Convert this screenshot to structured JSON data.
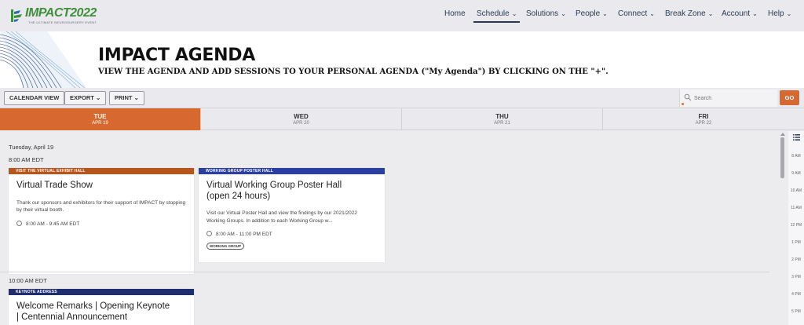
{
  "brand": {
    "name": "IMPACT2022",
    "tagline": "THE ULTIMATE NEUROSURGERY EVENT",
    "color": "#3f8f3a"
  },
  "nav": {
    "items": [
      {
        "label": "Home",
        "chevron": false
      },
      {
        "label": "Schedule",
        "chevron": true,
        "active": true
      },
      {
        "label": "Solutions",
        "chevron": true
      },
      {
        "label": "People",
        "chevron": true
      },
      {
        "label": "Connect",
        "chevron": true
      },
      {
        "label": "Break Zone",
        "chevron": true
      },
      {
        "label": "Account",
        "chevron": true
      },
      {
        "label": "Help",
        "chevron": true
      }
    ]
  },
  "banner": {
    "title": "IMPACT AGENDA",
    "subtitle": "VIEW THE AGENDA AND ADD SESSIONS TO YOUR PERSONAL AGENDA (\"My Agenda\") BY CLICKING ON THE \"+\"."
  },
  "toolbar": {
    "calendar_view": "CALENDAR VIEW",
    "export": "EXPORT",
    "print": "PRINT",
    "search_placeholder": "Search",
    "go": "GO",
    "accent": "#d7682f"
  },
  "days": [
    {
      "name": "TUE",
      "date": "APR 19",
      "active": true
    },
    {
      "name": "WED",
      "date": "APR 20"
    },
    {
      "name": "THU",
      "date": "APR 21"
    },
    {
      "name": "FRI",
      "date": "APR 22"
    }
  ],
  "schedule": {
    "date_heading": "Tuesday, April 19",
    "slots": [
      {
        "time": "8:00 AM EDT"
      },
      {
        "time": "10:00 AM EDT"
      }
    ],
    "cards": [
      {
        "tag": "VISIT THE VIRTUAL EXHIBIT HALL",
        "tag_color": "#b5561f",
        "title": "Virtual Trade Show",
        "description": "Thank our sponsors and exhibitors for their support of IMPACT by stopping by their virtual booth.",
        "time": "8:00 AM - 9:45 AM EDT"
      },
      {
        "tag": "WORKING GROUP POSTER HALL",
        "tag_color": "#2b3fa0",
        "title": "Virtual Working Group Poster Hall (open 24 hours)",
        "description": "Visit our Virtual Poster Hall and view the findings by our 2021/2022 Working Groups. In addition to each Working Group w...",
        "time": "8:00 AM - 11:00 PM EDT",
        "badge": "WORKING GROUP"
      },
      {
        "tag": "KEYNOTE ADDRESS",
        "tag_color": "#1f2f6e",
        "title": "Welcome Remarks | Opening Keynote | Centennial Announcement"
      }
    ]
  },
  "timeline": {
    "hours": [
      "8 AM",
      "9 AM",
      "10 AM",
      "11 AM",
      "12 PM",
      "1 PM",
      "2 PM",
      "3 PM",
      "4 PM",
      "5 PM"
    ]
  },
  "icons": [
    "impact-logo-icon",
    "chevron-down-icon",
    "search-icon",
    "clock-icon",
    "list-view-icon",
    "scroll-up-icon"
  ]
}
